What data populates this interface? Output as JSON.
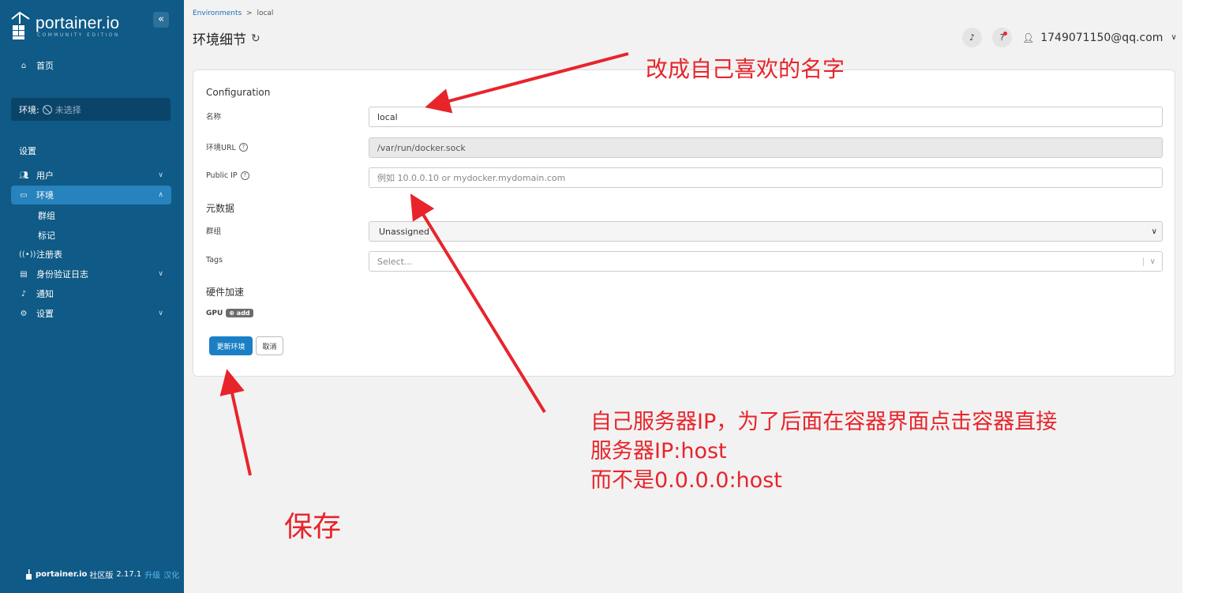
{
  "sidebar": {
    "logo_name": "portainer.io",
    "logo_sub": "COMMUNITY EDITION",
    "collapse_icon": "«",
    "home_label": "首页",
    "env_label": "环境:",
    "env_value": "未选择",
    "settings_title": "设置",
    "items": [
      {
        "label": "用户",
        "icon": "users-icon"
      },
      {
        "label": "环境",
        "icon": "environment-icon"
      },
      {
        "label": "注册表",
        "icon": "registry-icon"
      },
      {
        "label": "身份验证日志",
        "icon": "auth-log-icon"
      },
      {
        "label": "通知",
        "icon": "bell-icon"
      },
      {
        "label": "设置",
        "icon": "gear-icon"
      }
    ],
    "sub_items": [
      "群组",
      "标记"
    ],
    "footer": {
      "name": "portainer.io",
      "edition": "社区版",
      "version": "2.17.1",
      "upgrade": "升级",
      "localize": "汉化"
    }
  },
  "header": {
    "breadcrumb_root": "Environments",
    "breadcrumb_sep": ">",
    "breadcrumb_current": "local",
    "title": "环境细节",
    "user": "1749071150@qq.com"
  },
  "form": {
    "section_config": "Configuration",
    "name_label": "名称",
    "name_value": "local",
    "url_label": "环境URL",
    "url_value": "/var/run/docker.sock",
    "public_ip_label": "Public IP",
    "public_ip_placeholder": "例如 10.0.0.10 or mydocker.mydomain.com",
    "section_meta": "元数据",
    "group_label": "群组",
    "group_value": "Unassigned",
    "tags_label": "Tags",
    "tags_placeholder": "Select...",
    "section_hw": "硬件加速",
    "gpu_label": "GPU",
    "gpu_add": "add",
    "update_button": "更新环境",
    "cancel_button": "取消"
  },
  "annotations": {
    "rename": "改成自己喜欢的名字",
    "ip_line1": "自己服务器IP，为了后面在容器界面点击容器直接",
    "ip_line2": "服务器IP:host",
    "ip_line3": "而不是0.0.0.0:host",
    "save": "保存",
    "color": "#e8242b"
  },
  "colors": {
    "sidebar": "#0f5a86",
    "accent": "#1a7fc4"
  }
}
